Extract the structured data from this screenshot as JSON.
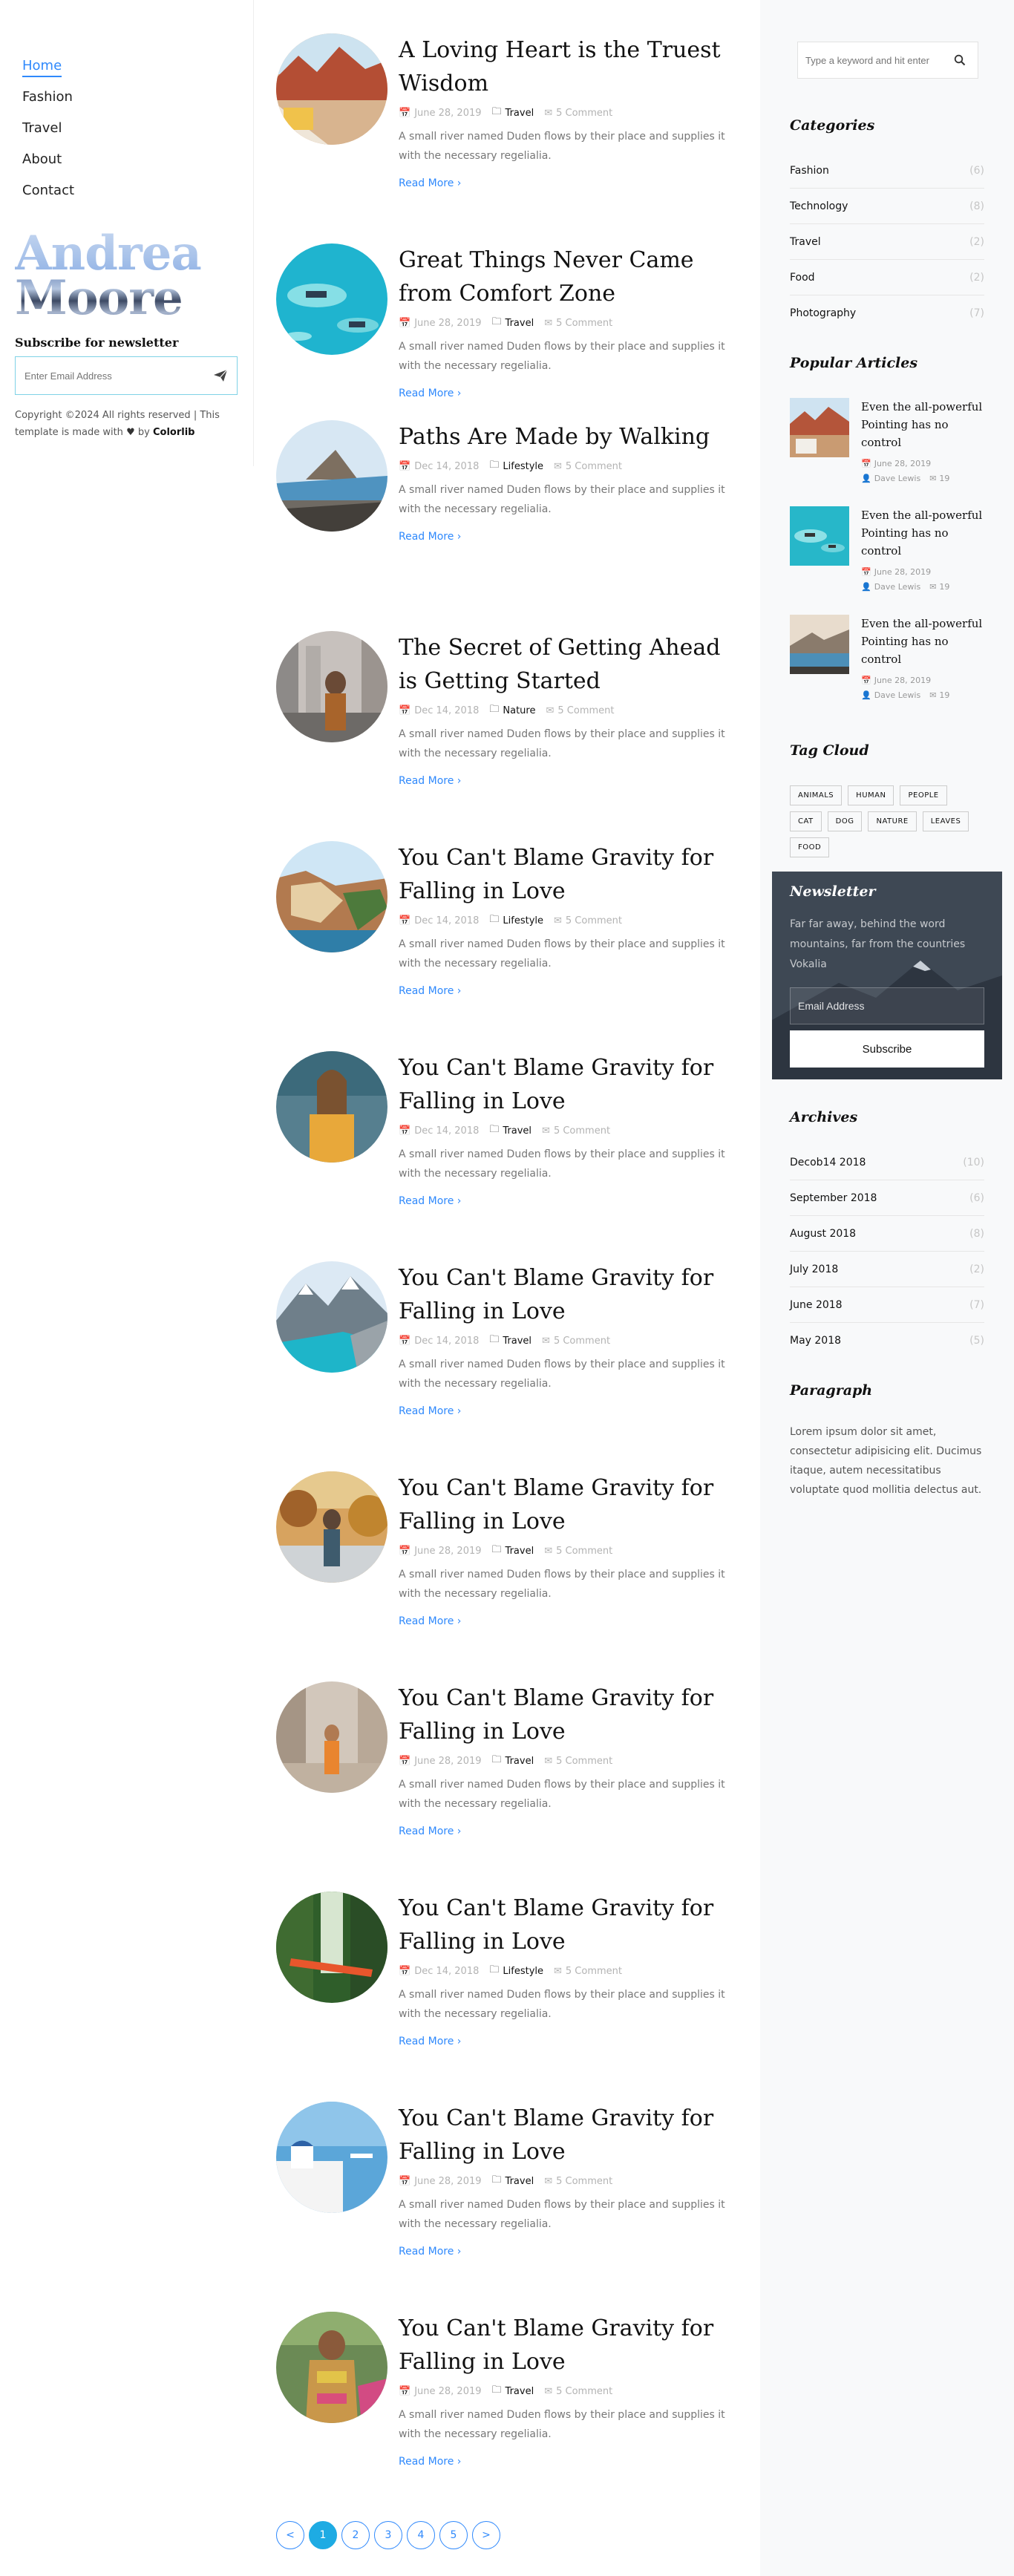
{
  "nav": {
    "items": [
      {
        "label": "Home"
      },
      {
        "label": "Fashion"
      },
      {
        "label": "Travel"
      },
      {
        "label": "About"
      },
      {
        "label": "Contact"
      }
    ]
  },
  "brand": {
    "line1": "Andrea",
    "line2": "Moore"
  },
  "subscribe": {
    "title": "Subscribe for newsletter",
    "placeholder": "Enter Email Address",
    "icon": "paper-plane-icon"
  },
  "footer": {
    "copyright_prefix": "Copyright ©2024 All rights reserved | This template is made with",
    "by": "by",
    "author": "Colorlib"
  },
  "posts": [
    {
      "title": "A Loving Heart is the Truest Wisdom",
      "date": "June 28, 2019",
      "category": "Travel",
      "comments": "5 Comment",
      "excerpt": "A small river named Duden flows by their place and supplies it with the necessary regelialia.",
      "read_more": "Read More"
    },
    {
      "title": "Great Things Never Came from Comfort Zone",
      "date": "June 28, 2019",
      "category": "Travel",
      "comments": "5 Comment",
      "excerpt": "A small river named Duden flows by their place and supplies it with the necessary regelialia.",
      "read_more": "Read More"
    },
    {
      "title": "Paths Are Made by Walking",
      "date": "Dec 14, 2018",
      "category": "Lifestyle",
      "comments": "5 Comment",
      "excerpt": "A small river named Duden flows by their place and supplies it with the necessary regelialia.",
      "read_more": "Read More"
    },
    {
      "title": "The Secret of Getting Ahead is Getting Started",
      "date": "Dec 14, 2018",
      "category": "Nature",
      "comments": "5 Comment",
      "excerpt": "A small river named Duden flows by their place and supplies it with the necessary regelialia.",
      "read_more": "Read More"
    },
    {
      "title": "You Can't Blame Gravity for Falling in Love",
      "date": "Dec 14, 2018",
      "category": "Lifestyle",
      "comments": "5 Comment",
      "excerpt": "A small river named Duden flows by their place and supplies it with the necessary regelialia.",
      "read_more": "Read More"
    },
    {
      "title": "You Can't Blame Gravity for Falling in Love",
      "date": "Dec 14, 2018",
      "category": "Travel",
      "comments": "5 Comment",
      "excerpt": "A small river named Duden flows by their place and supplies it with the necessary regelialia.",
      "read_more": "Read More"
    },
    {
      "title": "You Can't Blame Gravity for Falling in Love",
      "date": "Dec 14, 2018",
      "category": "Travel",
      "comments": "5 Comment",
      "excerpt": "A small river named Duden flows by their place and supplies it with the necessary regelialia.",
      "read_more": "Read More"
    },
    {
      "title": "You Can't Blame Gravity for Falling in Love",
      "date": "June 28, 2019",
      "category": "Travel",
      "comments": "5 Comment",
      "excerpt": "A small river named Duden flows by their place and supplies it with the necessary regelialia.",
      "read_more": "Read More"
    },
    {
      "title": "You Can't Blame Gravity for Falling in Love",
      "date": "June 28, 2019",
      "category": "Travel",
      "comments": "5 Comment",
      "excerpt": "A small river named Duden flows by their place and supplies it with the necessary regelialia.",
      "read_more": "Read More"
    },
    {
      "title": "You Can't Blame Gravity for Falling in Love",
      "date": "Dec 14, 2018",
      "category": "Lifestyle",
      "comments": "5 Comment",
      "excerpt": "A small river named Duden flows by their place and supplies it with the necessary regelialia.",
      "read_more": "Read More"
    },
    {
      "title": "You Can't Blame Gravity for Falling in Love",
      "date": "June 28, 2019",
      "category": "Travel",
      "comments": "5 Comment",
      "excerpt": "A small river named Duden flows by their place and supplies it with the necessary regelialia.",
      "read_more": "Read More"
    },
    {
      "title": "You Can't Blame Gravity for Falling in Love",
      "date": "June 28, 2019",
      "category": "Travel",
      "comments": "5 Comment",
      "excerpt": "A small river named Duden flows by their place and supplies it with the necessary regelialia.",
      "read_more": "Read More"
    }
  ],
  "pagination": {
    "prev": "<",
    "pages": [
      "1",
      "2",
      "3",
      "4",
      "5"
    ],
    "current": "1",
    "next": ">"
  },
  "sidebar": {
    "search_placeholder": "Type a keyword and hit enter",
    "categories_title": "Categories",
    "categories": [
      {
        "name": "Fashion",
        "count": "(6)"
      },
      {
        "name": "Technology",
        "count": "(8)"
      },
      {
        "name": "Travel",
        "count": "(2)"
      },
      {
        "name": "Food",
        "count": "(2)"
      },
      {
        "name": "Photography",
        "count": "(7)"
      }
    ],
    "popular_title": "Popular Articles",
    "popular": [
      {
        "title": "Even the all-powerful Pointing has no control",
        "date": "June 28, 2019",
        "author": "Dave Lewis",
        "comments": "19"
      },
      {
        "title": "Even the all-powerful Pointing has no control",
        "date": "June 28, 2019",
        "author": "Dave Lewis",
        "comments": "19"
      },
      {
        "title": "Even the all-powerful Pointing has no control",
        "date": "June 28, 2019",
        "author": "Dave Lewis",
        "comments": "19"
      }
    ],
    "tag_title": "Tag Cloud",
    "tags": [
      "ANIMALS",
      "HUMAN",
      "PEOPLE",
      "CAT",
      "DOG",
      "NATURE",
      "LEAVES",
      "FOOD"
    ],
    "newsletter": {
      "title": "Newsletter",
      "text": "Far far away, behind the word mountains, far from the countries Vokalia",
      "placeholder": "Email Address",
      "button": "Subscribe"
    },
    "archives_title": "Archives",
    "archives": [
      {
        "name": "Decob14 2018",
        "count": "(10)"
      },
      {
        "name": "September 2018",
        "count": "(6)"
      },
      {
        "name": "August 2018",
        "count": "(8)"
      },
      {
        "name": "July 2018",
        "count": "(2)"
      },
      {
        "name": "June 2018",
        "count": "(7)"
      },
      {
        "name": "May 2018",
        "count": "(5)"
      }
    ],
    "paragraph_title": "Paragraph",
    "paragraph": "Lorem ipsum dolor sit amet, consectetur adipisicing elit. Ducimus itaque, autem necessitatibus voluptate quod mollitia delectus aut."
  },
  "colors": {
    "accent": "#2f89fc",
    "pagination_active": "#1eabe3",
    "sidebar_bg": "#f8f9fa",
    "newsletter_bg": "#3a4450"
  }
}
